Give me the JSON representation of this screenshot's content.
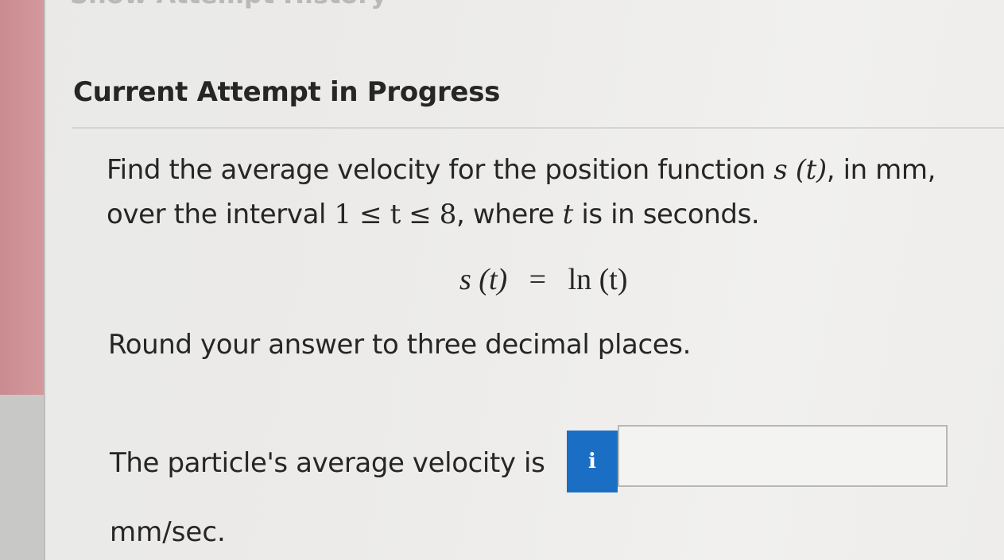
{
  "header": {
    "partial_title": "Show Attempt History",
    "title": "Current Attempt in Progress"
  },
  "question": {
    "line1_a": "Find the average velocity for the position function ",
    "line1_math": "s (t)",
    "line1_b": ", in mm,",
    "line2_a": "over the interval ",
    "line2_math": "1 ≤ t ≤ 8",
    "line2_b": ", where ",
    "line2_var": "t",
    "line2_c": " is in seconds.",
    "equation_lhs": "s (t)",
    "equation_eq": "=",
    "equation_rhs": "ln (t)",
    "instruction": "Round your answer to three decimal places."
  },
  "answer": {
    "label": "The particle's average velocity is",
    "info_icon": "i",
    "input_value": "",
    "unit": "mm/sec."
  },
  "colors": {
    "accent": "#1a6fc4",
    "sidebar": "#d4999d"
  }
}
